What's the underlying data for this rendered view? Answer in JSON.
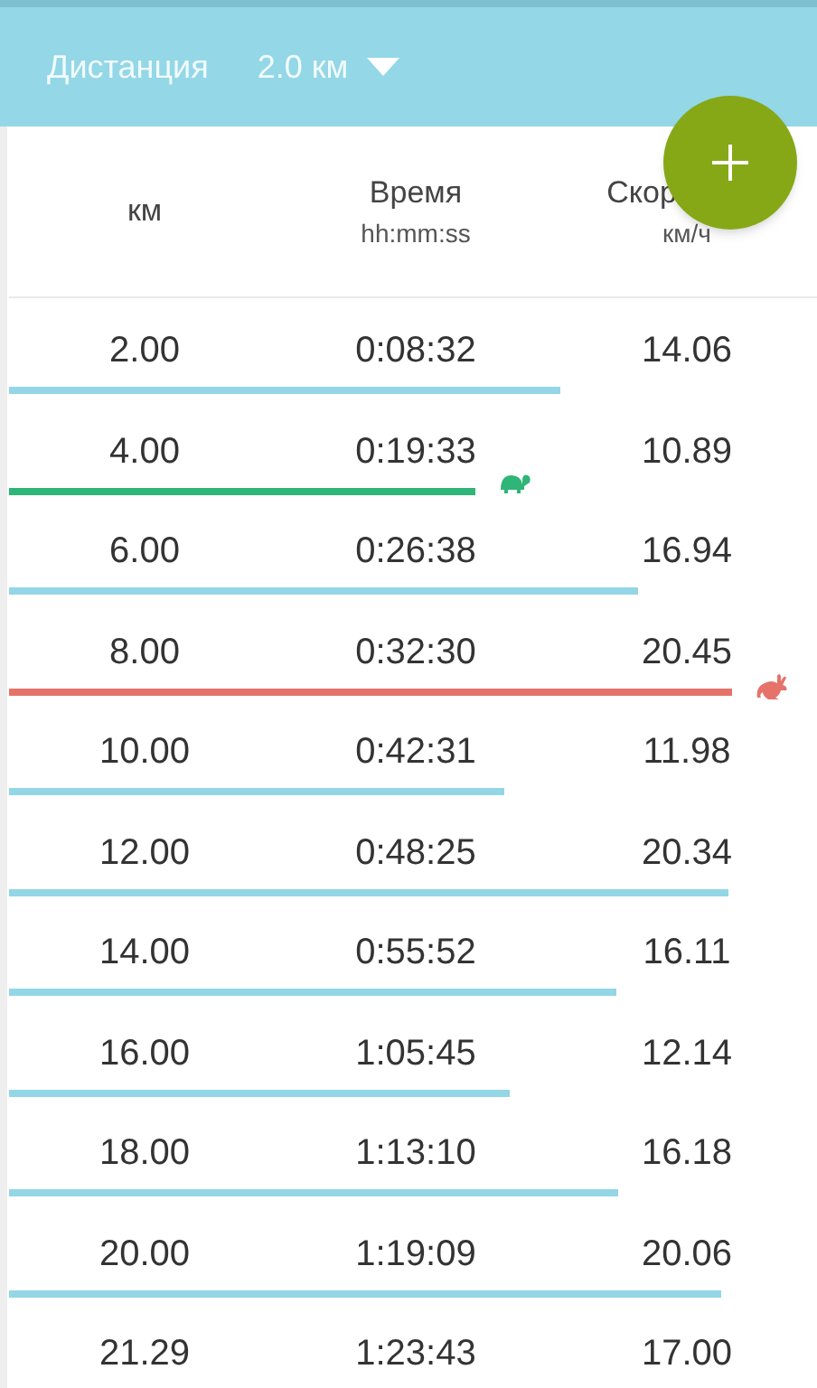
{
  "toolbar": {
    "label": "Дистанция",
    "distance": "2.0 км"
  },
  "columns": [
    {
      "title": "км"
    },
    {
      "title": "Время",
      "unit": "hh:mm:ss"
    },
    {
      "title": "Скор",
      "unit": "км/ч"
    }
  ],
  "rows": [
    {
      "km": "2.00",
      "time": "0:08:32",
      "speed": "14.06",
      "kind": "normal"
    },
    {
      "km": "4.00",
      "time": "0:19:33",
      "speed": "10.89",
      "kind": "slowest"
    },
    {
      "km": "6.00",
      "time": "0:26:38",
      "speed": "16.94",
      "kind": "normal"
    },
    {
      "km": "8.00",
      "time": "0:32:30",
      "speed": "20.45",
      "kind": "fastest"
    },
    {
      "km": "10.00",
      "time": "0:42:31",
      "speed": "11.98",
      "kind": "normal"
    },
    {
      "km": "12.00",
      "time": "0:48:25",
      "speed": "20.34",
      "kind": "normal"
    },
    {
      "km": "14.00",
      "time": "0:55:52",
      "speed": "16.11",
      "kind": "normal"
    },
    {
      "km": "16.00",
      "time": "1:05:45",
      "speed": "12.14",
      "kind": "normal"
    },
    {
      "km": "18.00",
      "time": "1:13:10",
      "speed": "16.18",
      "kind": "normal"
    },
    {
      "km": "20.00",
      "time": "1:19:09",
      "speed": "20.06",
      "kind": "normal"
    },
    {
      "km": "21.29",
      "time": "1:23:43",
      "speed": "17.00",
      "kind": "normal"
    }
  ]
}
